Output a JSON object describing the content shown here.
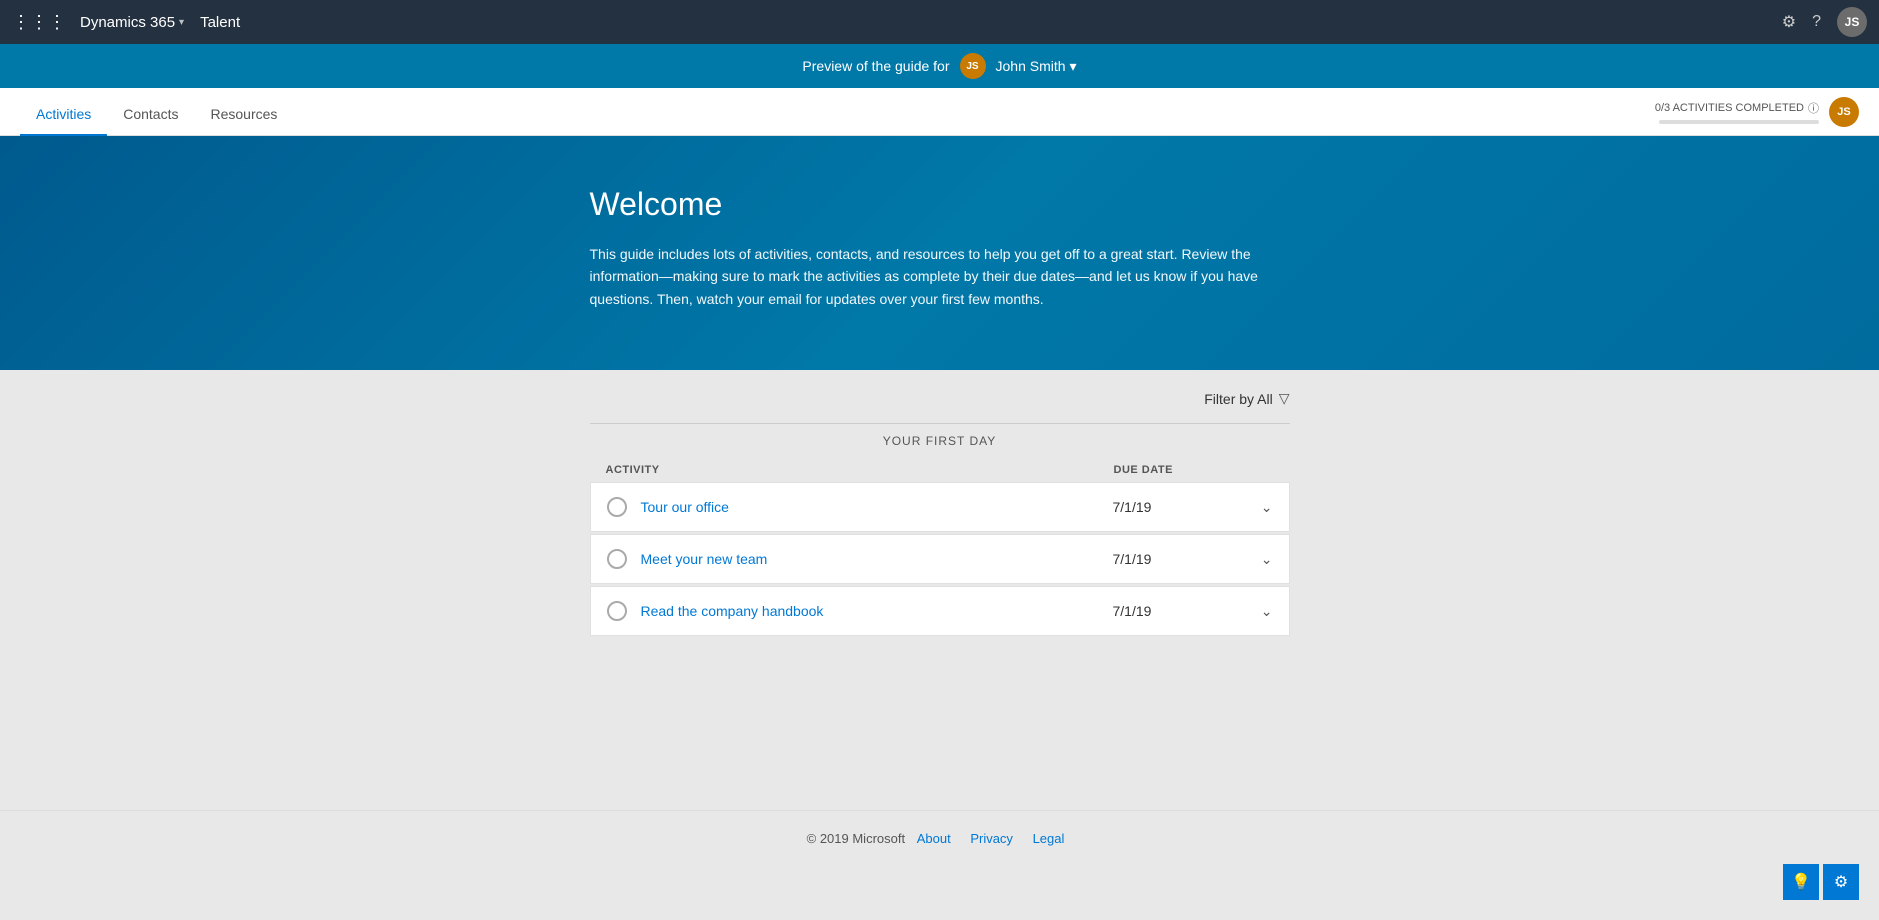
{
  "app": {
    "name": "Dynamics 365",
    "chevron": "▾",
    "module": "Talent"
  },
  "nav_icons": {
    "settings": "⚙",
    "help": "?",
    "waffle": "⊞"
  },
  "preview_bar": {
    "text": "Preview of the guide for",
    "user_initials": "JS",
    "user_name": "John Smith",
    "chevron": "▾"
  },
  "tabs": [
    {
      "label": "Activities",
      "active": true
    },
    {
      "label": "Contacts",
      "active": false
    },
    {
      "label": "Resources",
      "active": false
    }
  ],
  "progress": {
    "label": "0/3 ACTIVITIES COMPLETED",
    "info_icon": "ⓘ",
    "completed": 0,
    "total": 3,
    "percent": 0,
    "user_initials": "JS"
  },
  "hero": {
    "title": "Welcome",
    "description": "This guide includes lots of activities, contacts, and resources to help you get off to a great start. Review the information—making sure to mark the activities as complete by their due dates—and let us know if you have questions. Then, watch your email for updates over your first few months."
  },
  "filter": {
    "label": "Filter by All",
    "icon": "▽"
  },
  "section": {
    "title": "YOUR FIRST DAY"
  },
  "table_headers": {
    "activity": "ACTIVITY",
    "due_date": "DUE DATE"
  },
  "activities": [
    {
      "name": "Tour our office",
      "due_date": "7/1/19"
    },
    {
      "name": "Meet your new team",
      "due_date": "7/1/19"
    },
    {
      "name": "Read the company handbook",
      "due_date": "7/1/19"
    }
  ],
  "footer": {
    "copyright": "© 2019 Microsoft",
    "links": [
      "About",
      "Privacy",
      "Legal"
    ]
  },
  "floating_buttons": {
    "bulb_icon": "💡",
    "gear_icon": "⚙"
  }
}
